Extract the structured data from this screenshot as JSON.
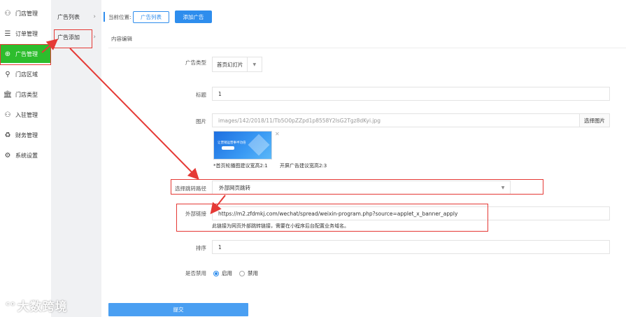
{
  "sidebar": {
    "items": [
      {
        "icon": "store-group-icon",
        "glyph": "⚇",
        "label": "门店管理",
        "active": false
      },
      {
        "icon": "list-icon",
        "glyph": "☰",
        "label": "订单管理",
        "active": false
      },
      {
        "icon": "ad-target-icon",
        "glyph": "⊕",
        "label": "广告管理",
        "active": true
      },
      {
        "icon": "location-pin-icon",
        "glyph": "⚲",
        "label": "门店区域",
        "active": false
      },
      {
        "icon": "bank-icon",
        "glyph": "🏛",
        "label": "门店类型",
        "active": false
      },
      {
        "icon": "users-icon",
        "glyph": "⚇",
        "label": "入驻管理",
        "active": false
      },
      {
        "icon": "finance-icon",
        "glyph": "♻",
        "label": "财务管理",
        "active": false
      },
      {
        "icon": "gear-icon",
        "glyph": "⚙",
        "label": "系统设置",
        "active": false
      }
    ]
  },
  "subnav": {
    "items": [
      {
        "label": "广告列表",
        "chevron": "›"
      },
      {
        "label": "广告添加",
        "chevron": "›"
      }
    ]
  },
  "breadcrumb": {
    "label": "当前位置:",
    "list_button": "广告列表",
    "add_button": "添加广告"
  },
  "section": {
    "tab": "内容编辑"
  },
  "form": {
    "ad_type": {
      "label": "广告类型",
      "value": "首页幻灯片"
    },
    "title": {
      "label": "标题",
      "value": "1"
    },
    "image": {
      "label": "图片",
      "path": "images/142/2018/11/Tb5O0pZZpd1p8558Y2IsG2Tgz8dKyi.jpg",
      "pick_button": "选择图片",
      "thumb_text": "让营销运营事半功倍",
      "hint_home": "*首页轮播图建议宽高2:1",
      "hint_launch": "开屏广告建议宽高2:3"
    },
    "jump": {
      "label": "选择跳转路径",
      "value": "外部网页跳转"
    },
    "external_link": {
      "label": "外部链接",
      "value": "https://m2.zfdmkj.com/wechat/spread/weixin-program.php?source=applet_x_banner_apply",
      "note": "此链接为网页外部跳转链接，需要在小程序后台配置业务域名。"
    },
    "sort": {
      "label": "排序",
      "value": "1"
    },
    "disabled": {
      "label": "是否禁用",
      "options": [
        "启用",
        "禁用"
      ],
      "selected": "启用"
    },
    "submit_label": "提交"
  },
  "watermark": {
    "text": "大数跨境"
  },
  "colors": {
    "accent": "#2e8ded",
    "active_nav": "#2dbd2d",
    "annotation": "#e53935"
  }
}
